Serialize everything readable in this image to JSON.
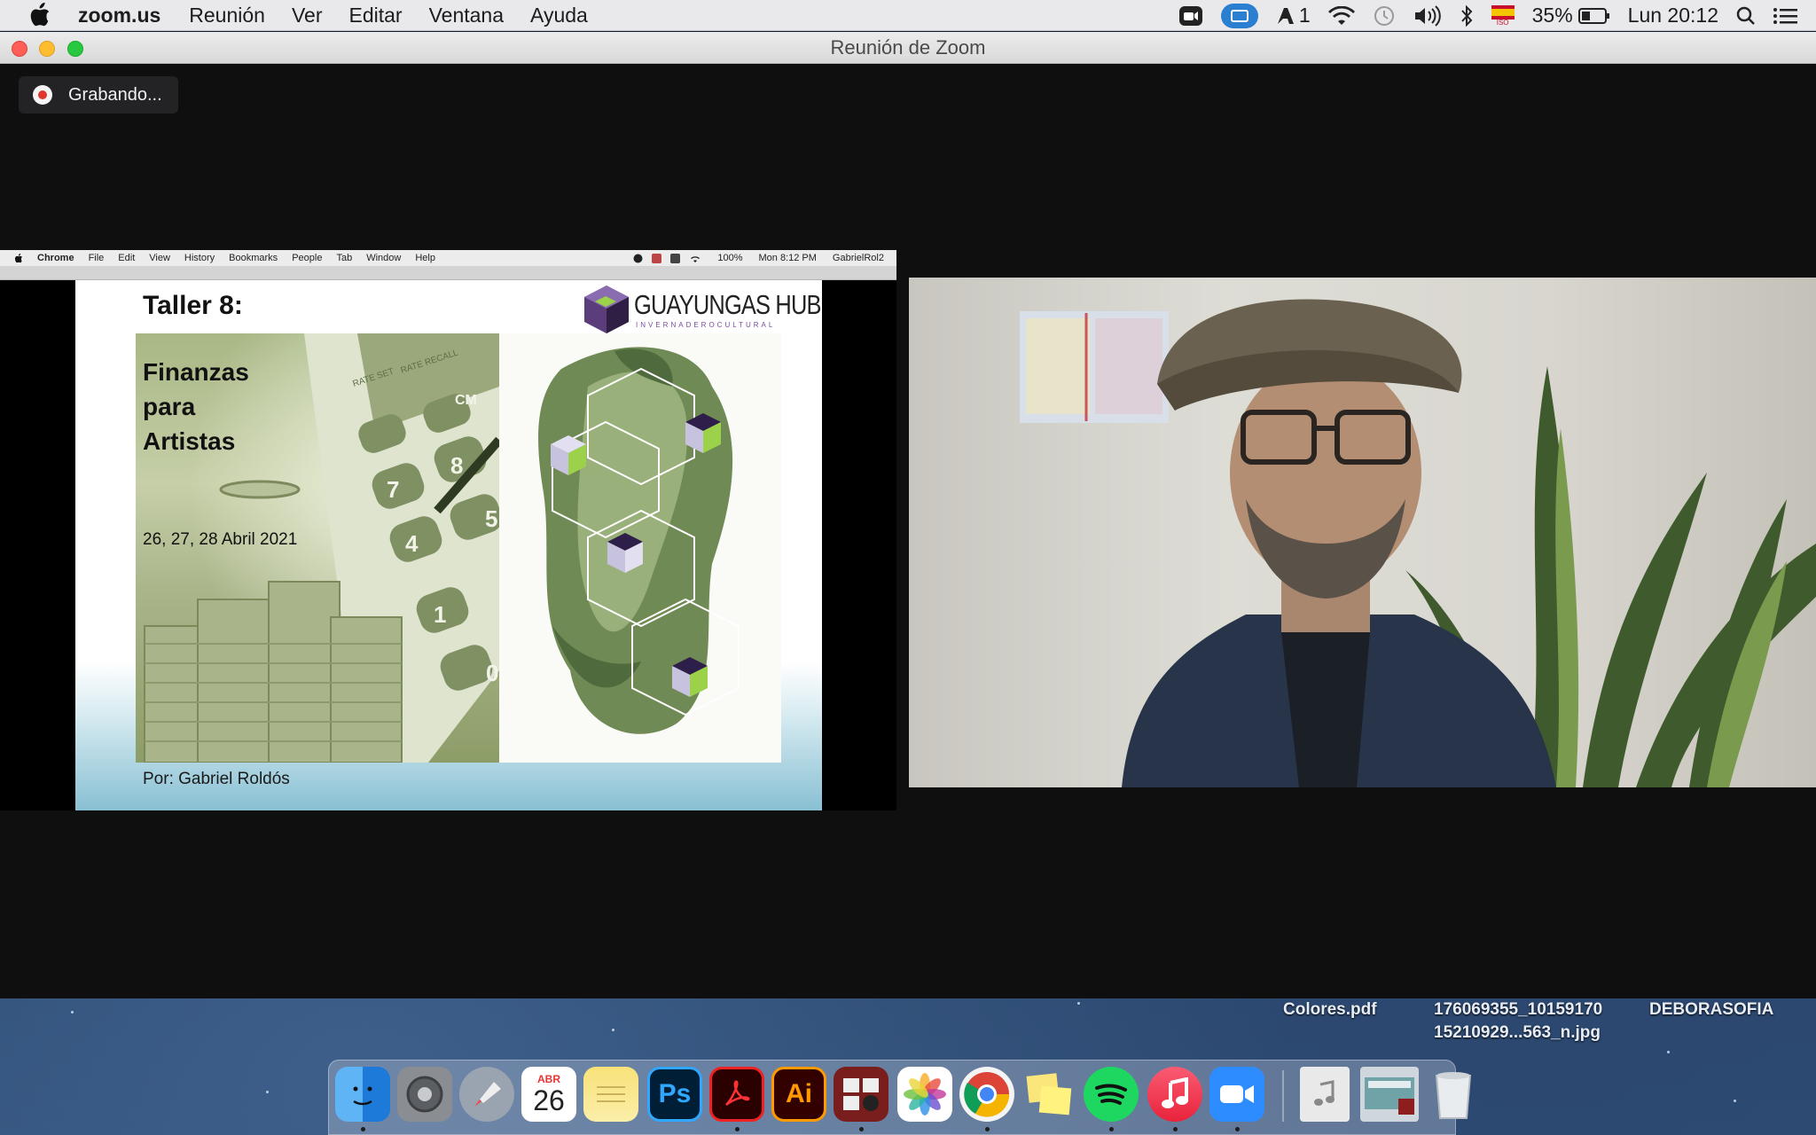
{
  "menubar": {
    "app_name": "zoom.us",
    "menus": [
      "Reunión",
      "Ver",
      "Editar",
      "Ventana",
      "Ayuda"
    ],
    "adobe_count": "1",
    "flag_label": "ISO",
    "battery_percent": "35%",
    "clock": "Lun 20:12"
  },
  "zoom_window": {
    "title": "Reunión de Zoom",
    "recording_label": "Grabando..."
  },
  "shared_screen": {
    "chrome_menu": {
      "app": "Chrome",
      "items": [
        "File",
        "Edit",
        "View",
        "History",
        "Bookmarks",
        "People",
        "Tab",
        "Window",
        "Help"
      ],
      "battery": "100%",
      "clock": "Mon 8:12 PM",
      "user": "GabrielRol2"
    },
    "slide": {
      "title": "Taller 8:",
      "subtitle_lines": [
        "Finanzas",
        "para",
        "Artistas"
      ],
      "dates": "26, 27, 28 Abril 2021",
      "author": "Por: Gabriel Roldós",
      "logo_text": "GUAYUNGAS HUB",
      "logo_subtext": "INVERNADEROCULTURAL",
      "calculator_keys": [
        "7",
        "8",
        "4",
        "5",
        "1",
        "0",
        "CM"
      ],
      "calculator_labels": [
        "RATE SET",
        "RATE RECALL"
      ]
    }
  },
  "desktop_files": [
    {
      "name": "Colores.pdf"
    },
    {
      "name_line1": "176069355_10159170",
      "name_line2": "15210929...563_n.jpg"
    },
    {
      "name": "DEBORASOFIA"
    }
  ],
  "dock": {
    "calendar_month": "ABR",
    "calendar_day": "26",
    "photoshop_label": "Ps",
    "illustrator_label": "Ai",
    "apps": [
      "finder",
      "system-preferences",
      "launchpad",
      "calendar",
      "notes",
      "photoshop",
      "acrobat",
      "illustrator",
      "photo-booth",
      "photos",
      "chrome",
      "stickies",
      "spotify",
      "music",
      "zoom",
      "itunes-doc",
      "preview-doc",
      "trash"
    ]
  },
  "colors": {
    "zoom_bg": "#0f0f10",
    "record_red": "#e0352c",
    "zoom_blue": "#2d8cff",
    "spotify_green": "#1ed760"
  }
}
